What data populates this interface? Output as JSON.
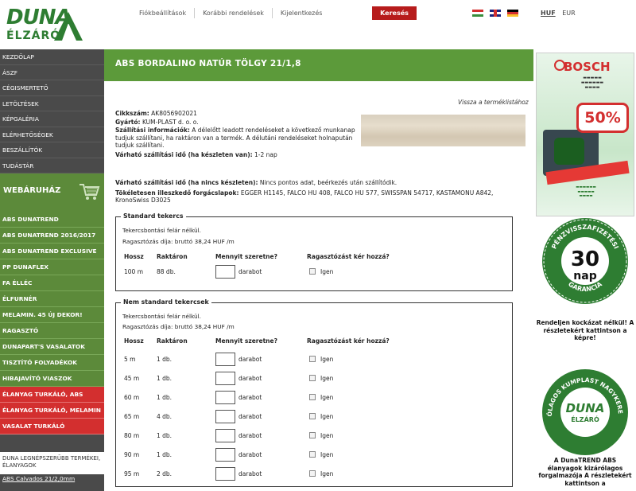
{
  "header": {
    "logo_text_top": "DUNA",
    "logo_text_bottom": "ÉLZÁRÓ",
    "nav": [
      "Fiókbeállítások",
      "Korábbi rendelések",
      "Kijelentkezés"
    ],
    "search_label": "Keresés",
    "currency_active": "HUF",
    "currency_other": "EUR"
  },
  "sidebar": {
    "menu": [
      "KEZDŐLAP",
      "ÁSZF",
      "CÉGISMERTETŐ",
      "LETÖLTÉSEK",
      "KÉPGALÉRIA",
      "ELÉRHETŐSÉGEK",
      "BESZÁLLÍTÓK",
      "TUDÁSTÁR"
    ],
    "shop_title": "WEBÁRUHÁZ",
    "shop_items": [
      "ABS DUNATREND",
      "ABS DUNATREND 2016/2017",
      "ABS DUNATREND EXCLUSIVE",
      "PP DUNAFLEX",
      "FA ÉLLÉC",
      "ÉLFURNÉR",
      "MELAMIN. 45 ÚJ DEKOR!",
      "RAGASZTÓ",
      "DUNAPART'S VASALATOK",
      "TISZTÍTÓ FOLYADÉKOK",
      "HIBAJAVÍTÓ VIASZOK"
    ],
    "shop_items_red": [
      "ÉLANYAG TURKÁLÓ, ABS",
      "ÉLANYAG TURKÁLÓ, MELAMIN",
      "VASALAT TURKÁLÓ"
    ],
    "popular_title": "DUNA LEGNÉPSZERŰBB TERMÉKEI, ÉLANYAGOK",
    "popular_items": [
      "ABS Calvados 21/2,0mm"
    ]
  },
  "product": {
    "title": "ABS BORDALINO NATÚR TÖLGY 21/1,8",
    "back_link": "Vissza a terméklistához",
    "sku_label": "Cikkszám:",
    "sku": "AK8056902021",
    "maker_label": "Gyártó:",
    "maker": "KUM-PLAST d. o. o.",
    "shipping_label": "Szállítási információk:",
    "shipping": "A délelőtt leadott rendeléseket a következő munkanap tudjuk szállítani, ha raktáron van a termék. A délutáni rendeléseket holnapután tudjuk szállítani.",
    "ship_in_stock_label": "Várható szállítási idő (ha készleten van):",
    "ship_in_stock": "1-2 nap",
    "ship_no_stock_label": "Várható szállítási idő (ha nincs készleten):",
    "ship_no_stock": "Nincs pontos adat, beérkezés után szállítódik.",
    "chips_label": "Tökéletesen illeszkedő forgácslapok:",
    "chips": "EGGER H1145, FALCO HU 408, FALCO HU 577, SWISSPAN 54717, KASTAMONU A842, KronoSwiss D3025"
  },
  "table_headers": {
    "length": "Hossz",
    "stock": "Raktáron",
    "qty": "Mennyit szeretne?",
    "glue": "Ragasztózást kér hozzá?"
  },
  "standard": {
    "legend": "Standard tekercs",
    "note1": "Tekercsbontási felár nélkül.",
    "note2": "Ragasztózás díja: bruttó 38,24 HUF /m",
    "rows": [
      {
        "length": "100 m",
        "stock": "88 db.",
        "unit": "darabot",
        "glue": "Igen"
      }
    ]
  },
  "nonstandard": {
    "legend": "Nem standard tekercsek",
    "note1": "Tekercsbontási felár nélkül.",
    "note2": "Ragasztózás díja: bruttó 38,24 HUF /m",
    "rows": [
      {
        "length": "5 m",
        "stock": "1 db.",
        "unit": "darabot",
        "glue": "Igen"
      },
      {
        "length": "45 m",
        "stock": "1 db.",
        "unit": "darabot",
        "glue": "Igen"
      },
      {
        "length": "60 m",
        "stock": "1 db.",
        "unit": "darabot",
        "glue": "Igen"
      },
      {
        "length": "65 m",
        "stock": "4 db.",
        "unit": "darabot",
        "glue": "Igen"
      },
      {
        "length": "80 m",
        "stock": "1 db.",
        "unit": "darabot",
        "glue": "Igen"
      },
      {
        "length": "90 m",
        "stock": "1 db.",
        "unit": "darabot",
        "glue": "Igen"
      },
      {
        "length": "95 m",
        "stock": "2 db.",
        "unit": "darabot",
        "glue": "Igen"
      }
    ]
  },
  "right": {
    "bosch_brand": "BOSCH",
    "bosch_percent": "50%",
    "badge1_center": "30",
    "badge1_unit": "nap",
    "badge1_ring_top": "PÉNZVISSZAFIZETÉSI",
    "badge1_ring_bottom": "GARANCIA",
    "badge1_caption": "Rendeljen kockázat nélkül! A részletekért kattintson a képre!",
    "badge2_center_top": "DUNA",
    "badge2_center_bottom": "ÉLZÁRÓ",
    "badge2_ring": "KIZÁRÓLAGOS KUMPLAST NAGYKERESKEDŐ",
    "badge2_caption": "A DunaTREND ABS élanyagok kizárólagos forgalmazója A részletekért kattintson a"
  }
}
